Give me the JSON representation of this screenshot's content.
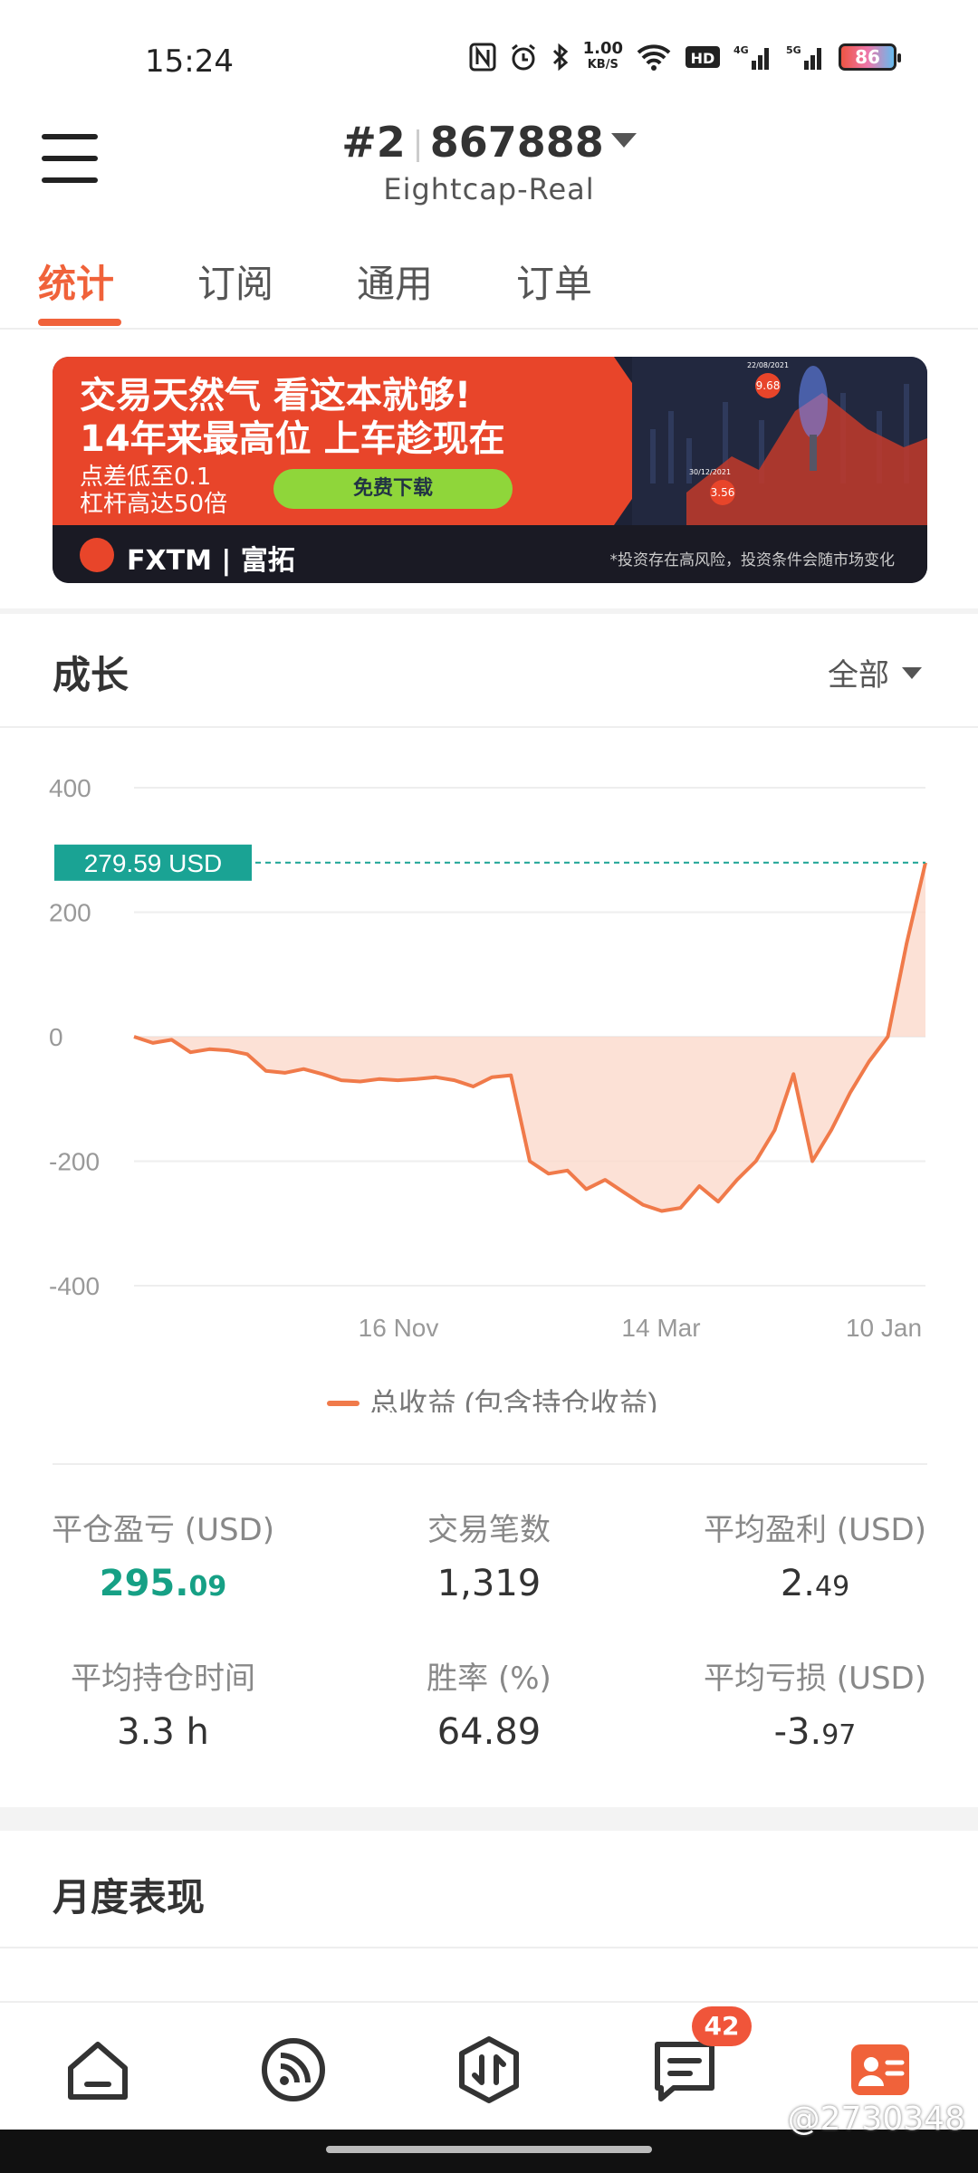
{
  "status": {
    "time": "15:24",
    "speed_top": "1.00",
    "speed_bottom": "KB/S",
    "battery": "86"
  },
  "header": {
    "account_prefix": "#2",
    "account_number": "867888",
    "broker": "Eightcap-Real"
  },
  "tabs": [
    {
      "label": "统计"
    },
    {
      "label": "订阅"
    },
    {
      "label": "通用"
    },
    {
      "label": "订单"
    }
  ],
  "banner": {
    "headline1": "交易天然气 看这本就够!",
    "headline2": "14年来最高位 上车趁现在",
    "sub1": "点差低至0.1",
    "sub2": "杠杆高达50倍",
    "button": "免费下载",
    "brand": "FXTM | 富拓",
    "disclaimer": "*投资存在高风险，投资条件会随市场变化",
    "marker_left_date": "30/12/2021",
    "marker_left_value": "3.56",
    "marker_right_date": "22/08/2021",
    "marker_right_value": "9.68"
  },
  "growth": {
    "title": "成长",
    "range": "全部"
  },
  "chart_data": {
    "type": "area",
    "current_label": "279.59 USD",
    "current_value": 279.59,
    "yticks": [
      "400",
      "200",
      "0",
      "-200",
      "-400"
    ],
    "ylim": [
      -400,
      400
    ],
    "xtick_labels": [
      "16 Nov",
      "14 Mar",
      "10 Jan"
    ],
    "legend": "总收益 (包含持仓收益)",
    "line_color": "#f07a4a",
    "fill_color": "#fbd9cc",
    "ref_line_color": "#1aa394",
    "series": [
      {
        "name": "总收益 (包含持仓收益)",
        "values": [
          0,
          -10,
          -5,
          -25,
          -20,
          -22,
          -28,
          -55,
          -58,
          -52,
          -60,
          -70,
          -72,
          -68,
          -70,
          -68,
          -65,
          -70,
          -80,
          -65,
          -62,
          -200,
          -220,
          -215,
          -245,
          -230,
          -250,
          -270,
          -280,
          -275,
          -240,
          -265,
          -230,
          -200,
          -150,
          -60,
          -200,
          -150,
          -90,
          -40,
          0,
          150,
          279.59
        ]
      }
    ]
  },
  "stats": [
    {
      "label": "平仓盈亏 (USD)",
      "value_main": "295.",
      "value_small": "09"
    },
    {
      "label": "交易笔数",
      "value_main": "1,319",
      "value_small": ""
    },
    {
      "label": "平均盈利 (USD)",
      "value_main": "2.",
      "value_small": "49"
    },
    {
      "label": "平均持仓时间",
      "value_main": "3.3 h",
      "value_small": ""
    },
    {
      "label": "胜率 (%)",
      "value_main": "64.89",
      "value_small": ""
    },
    {
      "label": "平均亏损 (USD)",
      "value_main": "-3.",
      "value_small": "97"
    }
  ],
  "monthly": {
    "title": "月度表现"
  },
  "nav": {
    "badge": "42",
    "watermark": "@2730348"
  },
  "colors": {
    "accent": "#f0623a",
    "positive": "#16a085"
  }
}
